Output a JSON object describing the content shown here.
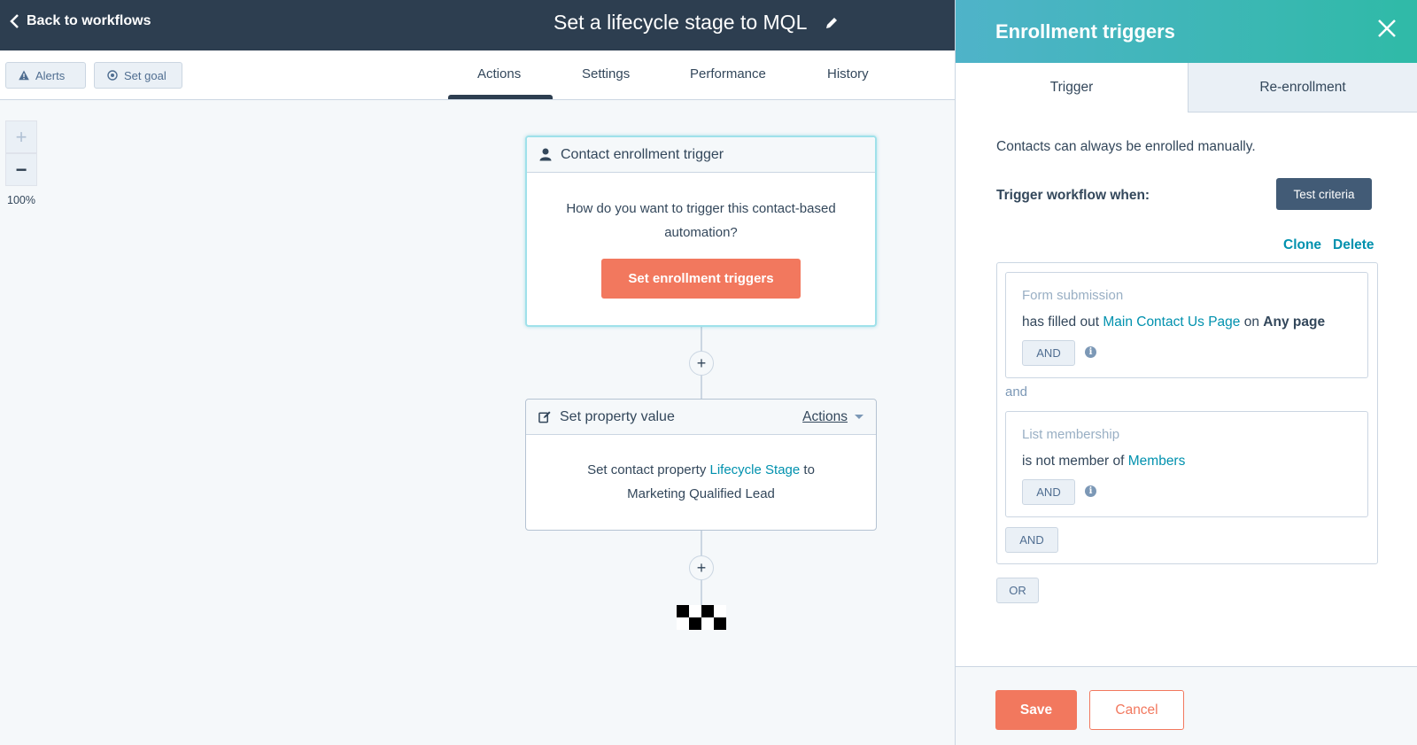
{
  "header": {
    "back_label": "Back to workflows",
    "workflow_title": "Set a lifecycle stage to MQL"
  },
  "toolbar": {
    "alerts_label": "Alerts",
    "set_goal_label": "Set goal",
    "tabs": [
      "Actions",
      "Settings",
      "Performance",
      "History"
    ],
    "active_tab": "Actions"
  },
  "zoom": {
    "plus": "+",
    "minus": "−",
    "level": "100%"
  },
  "canvas": {
    "trigger_card": {
      "header": "Contact enrollment trigger",
      "question": "How do you want to trigger this contact-based automation?",
      "button_label": "Set enrollment triggers"
    },
    "action_card": {
      "header": "Set property value",
      "actions_label": "Actions",
      "body_prefix": "Set contact property",
      "property": "Lifecycle Stage",
      "body_to": "to",
      "value": "Marketing Qualified Lead"
    },
    "add_step": "+"
  },
  "panel": {
    "title": "Enrollment triggers",
    "tabs": [
      "Trigger",
      "Re-enrollment"
    ],
    "active_tab": "Trigger",
    "manual_note": "Contacts can always be enrolled manually.",
    "trigger_when_label": "Trigger workflow when:",
    "test_criteria_label": "Test criteria",
    "clone_label": "Clone",
    "delete_label": "Delete",
    "filters": [
      {
        "type": "Form submission",
        "text_prefix": "has filled out",
        "link": "Main Contact Us Page",
        "text_mid": "on",
        "bold": "Any page",
        "and_label": "AND"
      },
      {
        "type": "List membership",
        "text_prefix": "is not member of",
        "link": "Members",
        "and_label": "AND"
      }
    ],
    "between_label": "and",
    "group_and_label": "AND",
    "or_label": "OR",
    "save_label": "Save",
    "cancel_label": "Cancel"
  },
  "colors": {
    "header_bg": "#2d3e50",
    "accent_orange": "#f2785e",
    "link_teal": "#0091ae",
    "panel_header_start": "#4fb3c9",
    "panel_header_end": "#2fbaa7"
  },
  "icons": [
    "chevron-left-icon",
    "pencil-icon",
    "warning-icon",
    "target-icon",
    "person-icon",
    "edit-square-icon",
    "caret-down-icon",
    "close-icon",
    "info-icon",
    "finish-flag-icon"
  ]
}
